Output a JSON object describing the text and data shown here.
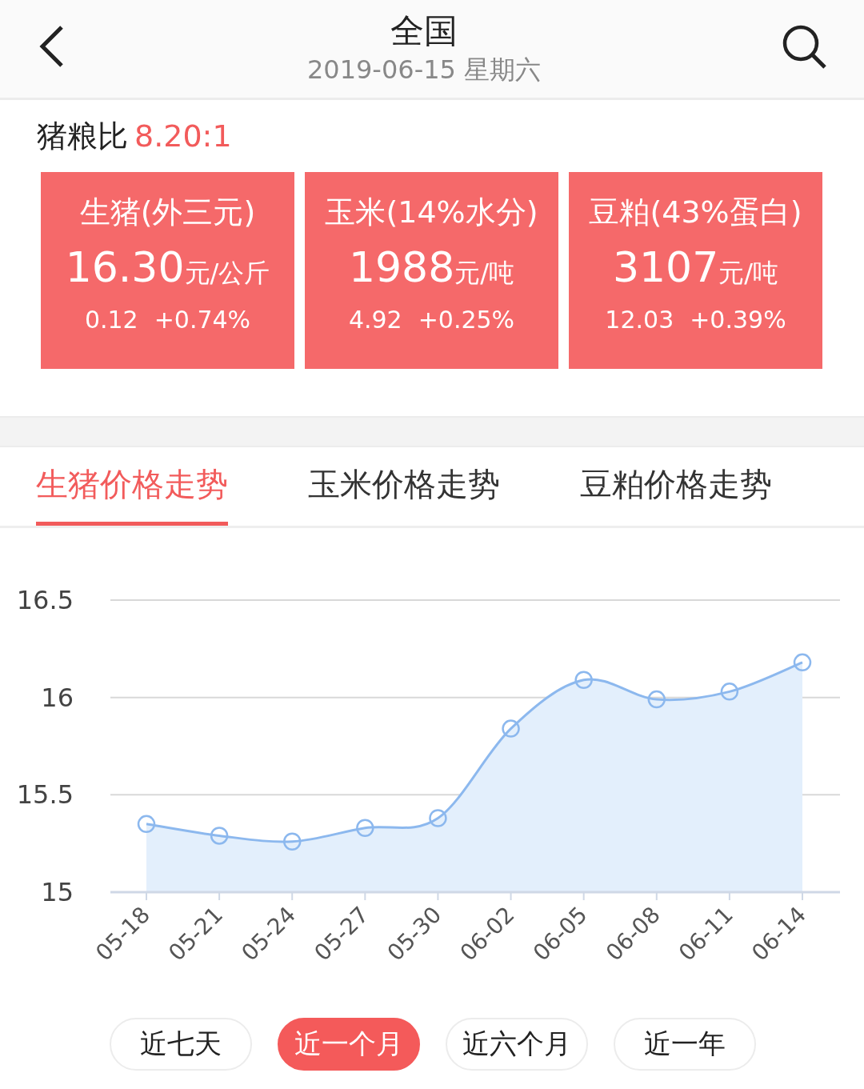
{
  "header": {
    "title": "全国",
    "subtitle": "2019-06-15 星期六"
  },
  "ratio": {
    "label": "猪粮比",
    "value": "8.20:1"
  },
  "cards": [
    {
      "name": "生猪(外三元)",
      "price": "16.30",
      "unit": "元/公斤",
      "change": "0.12",
      "percent": "+0.74%"
    },
    {
      "name": "玉米(14%水分)",
      "price": "1988",
      "unit": "元/吨",
      "change": "4.92",
      "percent": "+0.25%"
    },
    {
      "name": "豆粕(43%蛋白)",
      "price": "3107",
      "unit": "元/吨",
      "change": "12.03",
      "percent": "+0.39%"
    }
  ],
  "tabs": [
    {
      "label": "生猪价格走势",
      "selected": true
    },
    {
      "label": "玉米价格走势",
      "selected": false
    },
    {
      "label": "豆粕价格走势",
      "selected": false
    }
  ],
  "chart": {
    "chart_data": {
      "type": "area",
      "categories": [
        "05-18",
        "05-21",
        "05-24",
        "05-27",
        "05-30",
        "06-02",
        "06-05",
        "06-08",
        "06-11",
        "06-14"
      ],
      "series": [
        {
          "color": "#8cb8ee",
          "values": [
            15.35,
            15.29,
            15.26,
            15.33,
            15.38,
            15.84,
            16.09,
            15.99,
            16.03,
            16.18
          ]
        }
      ],
      "ylim": [
        15,
        16.5
      ],
      "yticks": [
        {
          "value": 15,
          "label": "15"
        },
        {
          "value": 15.5,
          "label": "15.5"
        },
        {
          "value": 16,
          "label": "16"
        },
        {
          "value": 16.5,
          "label": "16.5"
        }
      ]
    }
  },
  "ranges": [
    {
      "label": "近七天",
      "selected": false
    },
    {
      "label": "近一个月",
      "selected": true
    },
    {
      "label": "近六个月",
      "selected": false
    },
    {
      "label": "近一年",
      "selected": false
    }
  ]
}
